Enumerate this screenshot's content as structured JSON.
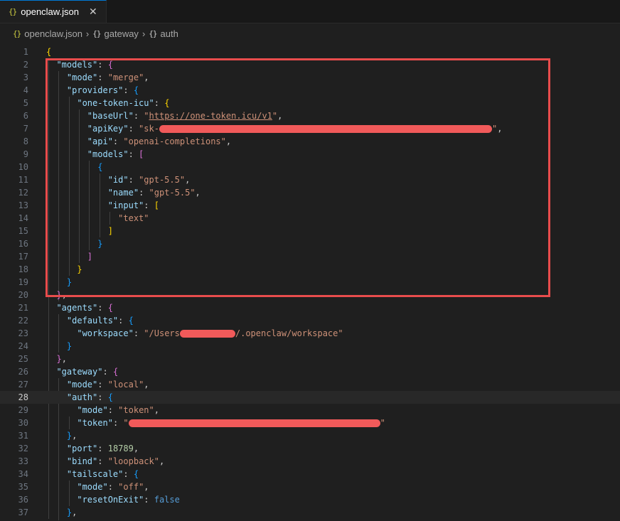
{
  "tab": {
    "icon": "{}",
    "filename": "openclaw.json",
    "close_glyph": "✕"
  },
  "breadcrumb": {
    "file": "openclaw.json",
    "seg1": "gateway",
    "seg2": "auth",
    "obj_icon": "{}",
    "separator": "›"
  },
  "editor": {
    "current_line": 28,
    "lines": [
      {
        "n": "1"
      },
      {
        "n": "2"
      },
      {
        "n": "3"
      },
      {
        "n": "4"
      },
      {
        "n": "5"
      },
      {
        "n": "6"
      },
      {
        "n": "7"
      },
      {
        "n": "8"
      },
      {
        "n": "9"
      },
      {
        "n": "10"
      },
      {
        "n": "11"
      },
      {
        "n": "12"
      },
      {
        "n": "13"
      },
      {
        "n": "14"
      },
      {
        "n": "15"
      },
      {
        "n": "16"
      },
      {
        "n": "17"
      },
      {
        "n": "18"
      },
      {
        "n": "19"
      },
      {
        "n": "20"
      },
      {
        "n": "21"
      },
      {
        "n": "22"
      },
      {
        "n": "23"
      },
      {
        "n": "24"
      },
      {
        "n": "25"
      },
      {
        "n": "26"
      },
      {
        "n": "27"
      },
      {
        "n": "28"
      },
      {
        "n": "29"
      },
      {
        "n": "30"
      },
      {
        "n": "31"
      },
      {
        "n": "32"
      },
      {
        "n": "33"
      },
      {
        "n": "34"
      },
      {
        "n": "35"
      },
      {
        "n": "36"
      },
      {
        "n": "37"
      }
    ],
    "text": {
      "models_key": "\"models\"",
      "mode_key": "\"mode\"",
      "merge_val": "\"merge\"",
      "providers_key": "\"providers\"",
      "one_token_key": "\"one-token-icu\"",
      "baseurl_key": "\"baseUrl\"",
      "baseurl_val": "https://one-token.icu/v1",
      "apikey_key": "\"apiKey\"",
      "apikey_prefix": "\"sk-",
      "api_key": "\"api\"",
      "api_val": "\"openai-completions\"",
      "models_inner_key": "\"models\"",
      "id_key": "\"id\"",
      "id_val": "\"gpt-5.5\"",
      "name_key": "\"name\"",
      "name_val": "\"gpt-5.5\"",
      "input_key": "\"input\"",
      "text_val": "\"text\"",
      "agents_key": "\"agents\"",
      "defaults_key": "\"defaults\"",
      "workspace_key": "\"workspace\"",
      "workspace_prefix": "\"/Users",
      "workspace_suffix": "/.openclaw/workspace\"",
      "gateway_key": "\"gateway\"",
      "local_val": "\"local\"",
      "auth_key": "\"auth\"",
      "token_key": "\"token\"",
      "token_mode_val": "\"token\"",
      "port_key": "\"port\"",
      "port_val": "18789",
      "bind_key": "\"bind\"",
      "bind_val": "\"loopback\"",
      "tailscale_key": "\"tailscale\"",
      "off_val": "\"off\"",
      "reset_key": "\"resetOnExit\"",
      "reset_val": "false"
    }
  },
  "colors": {
    "highlight_box": "#e84c4c",
    "redaction": "#f15a5a",
    "string": "#ce9178",
    "key": "#9cdcfe"
  }
}
